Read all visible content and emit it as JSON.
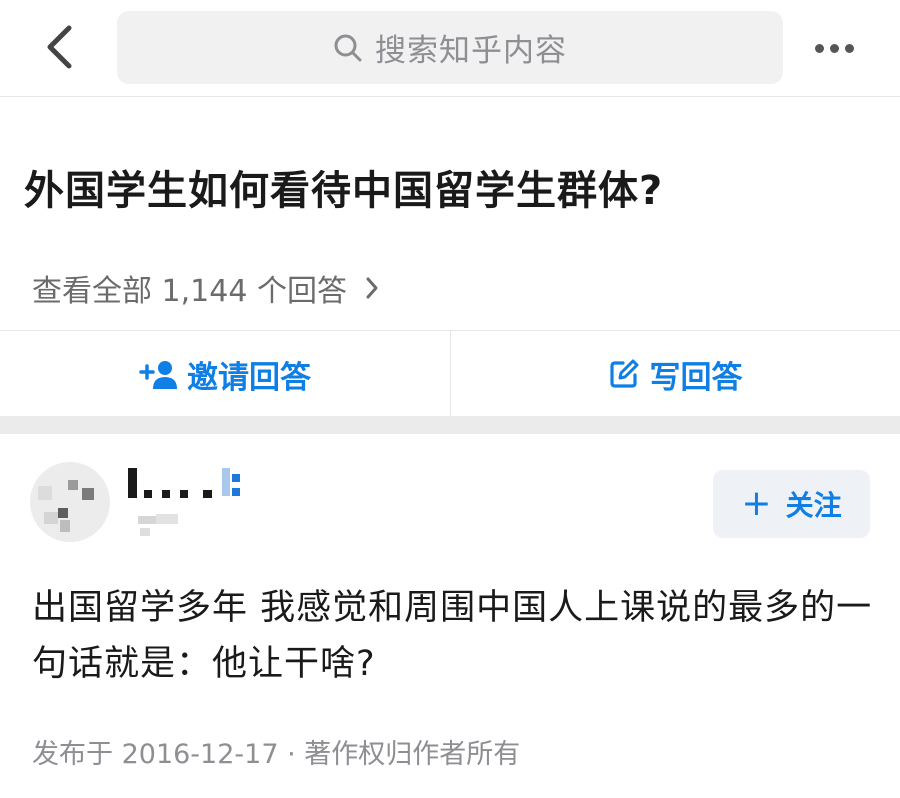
{
  "header": {
    "search_placeholder": "搜索知乎内容",
    "back_icon": "chevron-left-icon",
    "more_icon": "more-dots-icon"
  },
  "question": {
    "title": "外国学生如何看待中国留学生群体?",
    "view_all_label": "查看全部 1,144 个回答",
    "answer_count": "1,144"
  },
  "actions": {
    "invite_label": "邀请回答",
    "write_label": "写回答"
  },
  "answer": {
    "author_name": "",
    "follow_label": "关注",
    "content": "出国留学多年 我感觉和周围中国人上课说的最多的一句话就是：他让干啥?",
    "meta": "发布于 2016-12-17 · 著作权归作者所有"
  },
  "colors": {
    "accent": "#0f7fe6",
    "background": "#ffffff",
    "separator": "#ebebeb",
    "muted_text": "#8e8e93"
  }
}
